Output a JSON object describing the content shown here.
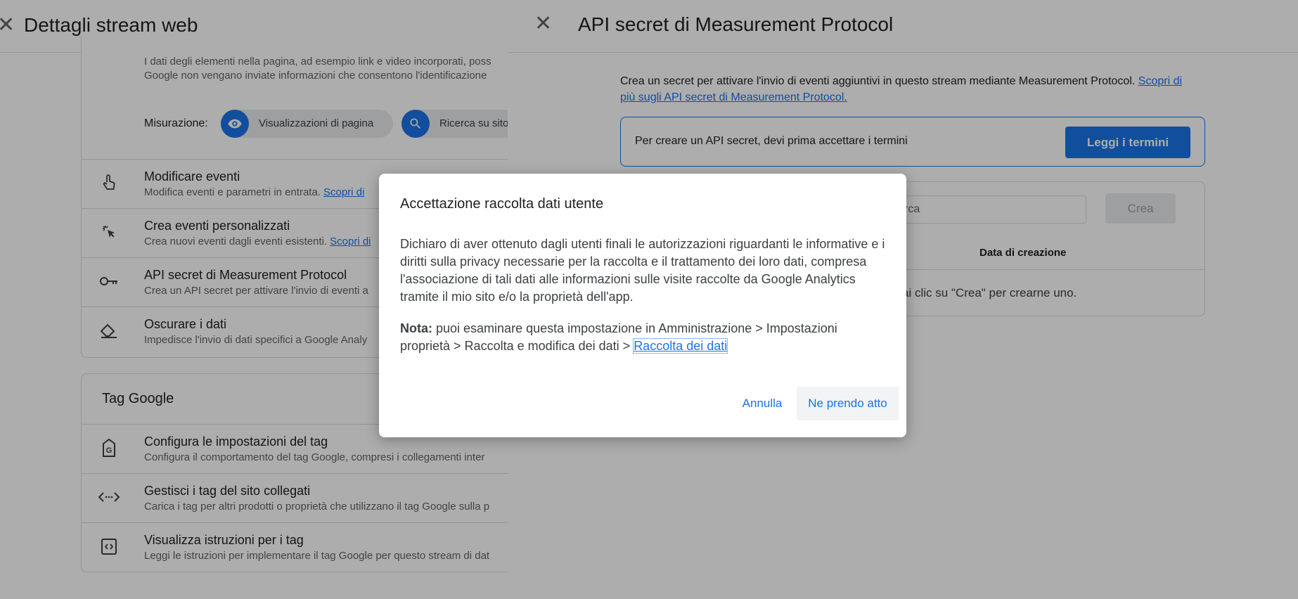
{
  "left_panel": {
    "title": "Dettagli stream web",
    "enhanced_text_1": "I dati degli elementi nella pagina, ad esempio link e video incorporati, poss",
    "enhanced_text_2": "Google non vengano inviate informazioni che consentono l'identificazione",
    "measurement_label": "Misurazione:",
    "chips": [
      "Visualizzazioni di pagina",
      "Ricerca su sito"
    ],
    "rows": [
      {
        "title": "Modificare eventi",
        "desc": "Modifica eventi e parametri in entrata.",
        "link": "Scopri di"
      },
      {
        "title": "Crea eventi personalizzati",
        "desc": "Crea nuovi eventi dagli eventi esistenti.",
        "link": "Scopri di"
      },
      {
        "title": "API secret di Measurement Protocol",
        "desc": "Crea un API secret per attivare l'invio di eventi a",
        "link": ""
      },
      {
        "title": "Oscurare i dati",
        "desc": "Impedisce l'invio di dati specifici a Google Analy",
        "link": ""
      }
    ],
    "tag_section_title": "Tag Google",
    "tag_rows": [
      {
        "title": "Configura le impostazioni del tag",
        "desc": "Configura il comportamento del tag Google, compresi i collegamenti inter"
      },
      {
        "title": "Gestisci i tag del sito collegati",
        "desc": "Carica i tag per altri prodotti o proprietà che utilizzano il tag Google sulla p"
      },
      {
        "title": "Visualizza istruzioni per i tag",
        "desc": "Leggi le istruzioni per implementare il tag Google per questo stream di dat"
      }
    ]
  },
  "drawer": {
    "title": "API secret di Measurement Protocol",
    "intro": "Crea un secret per attivare l'invio di eventi aggiuntivi in questo stream mediante Measurement Protocol.",
    "intro_link": "Scopri di più sugli API secret di Measurement Protocol.",
    "terms_text": "Per creare un API secret, devi prima accettare i termini",
    "terms_button": "Leggi i termini",
    "search_placeholder": "rca",
    "create_button": "Crea",
    "col_date": "Data di creazione",
    "empty_text": "ai clic su \"Crea\" per crearne uno."
  },
  "dialog": {
    "title": "Accettazione raccolta dati utente",
    "body": "Dichiaro di aver ottenuto dagli utenti finali le autorizzazioni riguardanti le informative e i diritti sulla privacy necessarie per la raccolta e il trattamento dei loro dati, compresa l'associazione di tali dati alle informazioni sulle visite raccolte da Google Analytics tramite il mio sito e/o la proprietà dell'app.",
    "note_label": "Nota:",
    "note_text": " puoi esaminare questa impostazione in Amministrazione > Impostazioni proprietà > Raccolta e modifica dei dati > ",
    "note_link": "Raccolta dei dati",
    "cancel_button": "Annulla",
    "ack_button": "Ne prendo atto"
  },
  "colors": {
    "accent": "#1a73e8",
    "scrim": "rgba(0,0,0,0.32)"
  }
}
